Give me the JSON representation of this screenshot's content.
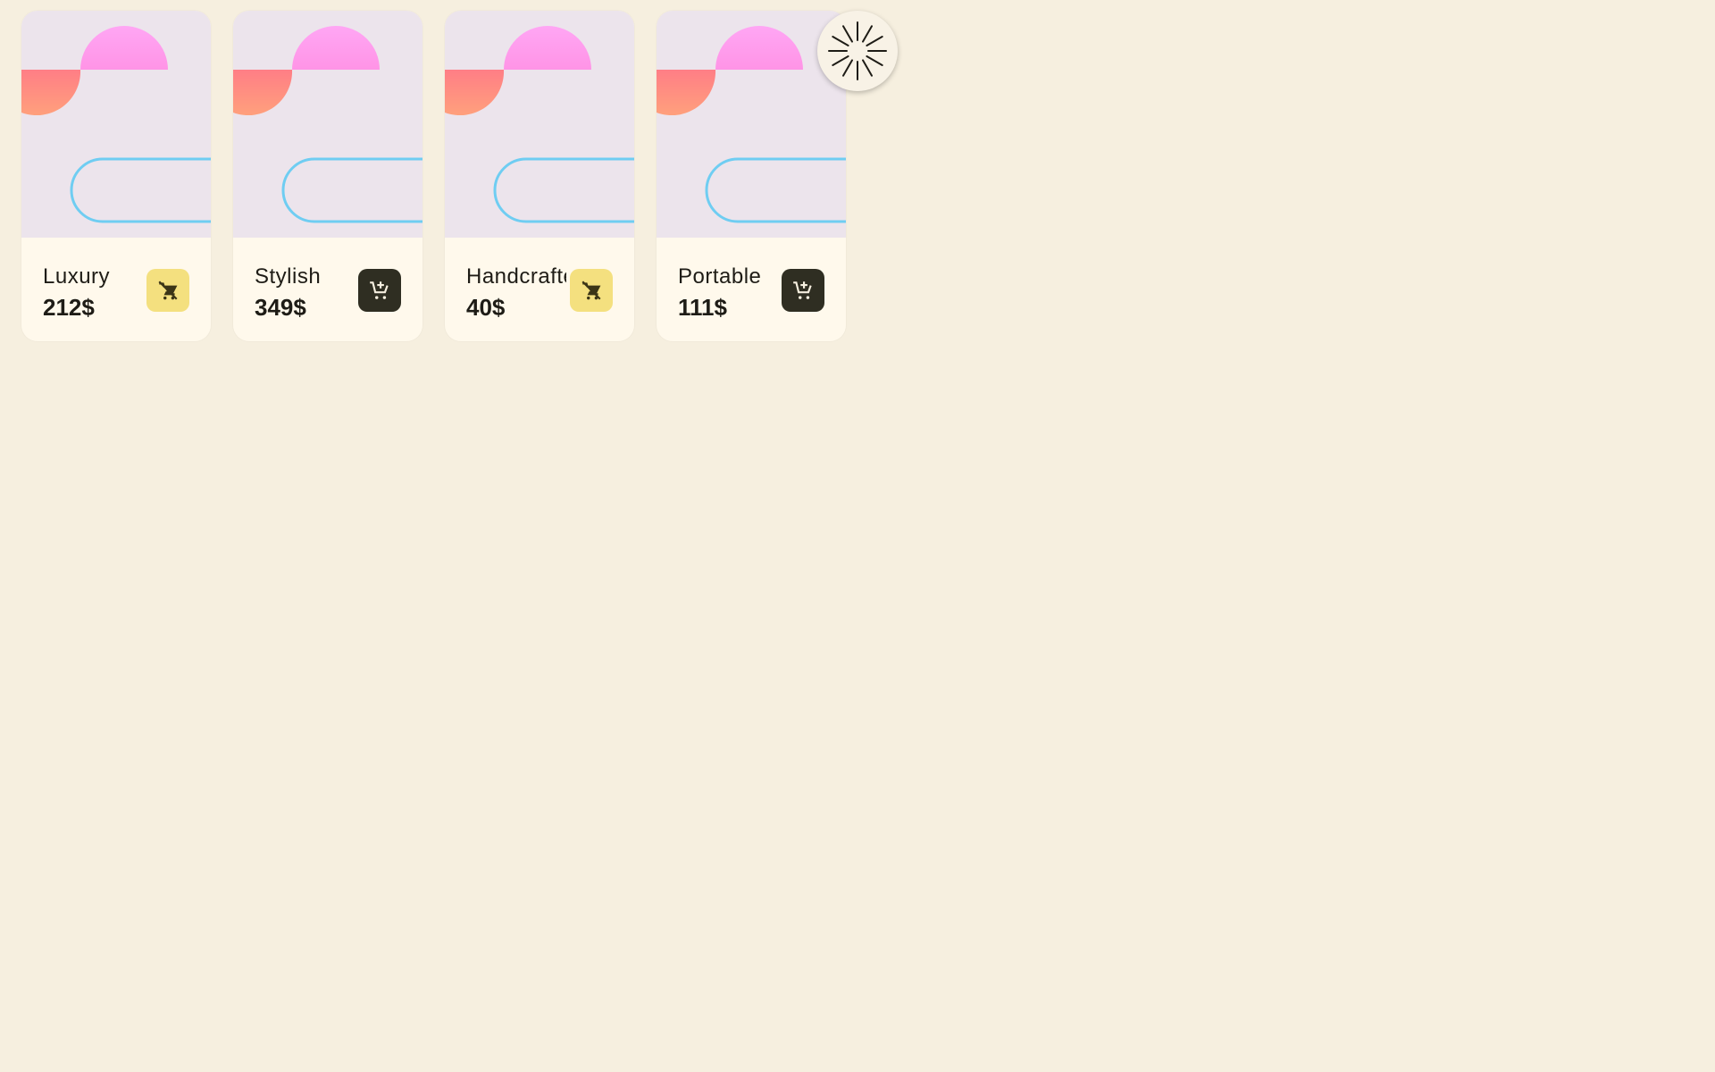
{
  "products": [
    {
      "name": "Luxury",
      "price": "212$",
      "in_cart": true,
      "cart_icon": "remove-shopping-cart-icon"
    },
    {
      "name": "Stylish",
      "price": "349$",
      "in_cart": false,
      "cart_icon": "add-shopping-cart-icon"
    },
    {
      "name": "Handcrafted",
      "price": "40$",
      "in_cart": true,
      "cart_icon": "remove-shopping-cart-icon"
    },
    {
      "name": "Portable",
      "price": "111$",
      "in_cart": false,
      "cart_icon": "add-shopping-cart-icon"
    }
  ],
  "colors": {
    "background": "#f6efdf",
    "card": "#fff9ec",
    "art_background": "#ece4ec",
    "in_cart_button": "#f4e07f",
    "add_button": "#2f2e22",
    "pink_top": "#ff9ff0",
    "coral": "#ff8a7a",
    "outline_blue": "#6fcdf2"
  },
  "fab": {
    "icon": "loading-spinner-icon"
  }
}
